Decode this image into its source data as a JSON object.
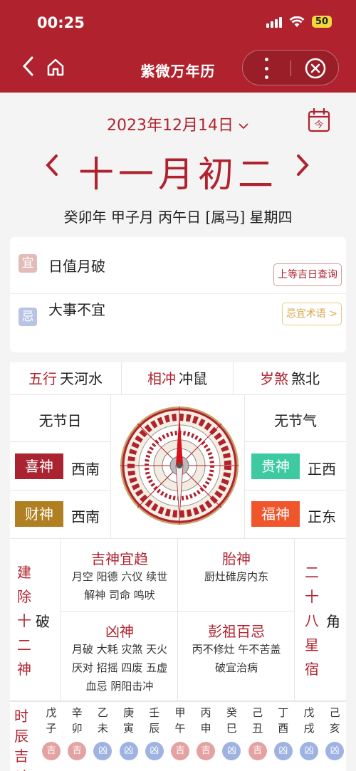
{
  "status": {
    "time": "00:25",
    "battery": "50"
  },
  "nav": {
    "title": "紫微万年历"
  },
  "date": {
    "solar": "2023年12月14日",
    "lunar": "十一月初二",
    "ganzhi": "癸卯年 甲子月 丙午日 [属马] 星期四",
    "today_label": "今"
  },
  "yiji": {
    "yi_badge": "宜",
    "yi_text": "日值月破",
    "yi_link": "上等吉日查询",
    "ji_badge": "忌",
    "ji_text": "大事不宜",
    "ji_link": "忌宜术语 >"
  },
  "info": {
    "wuxing_label": "五行",
    "wuxing_value": "天河水",
    "chong_label": "相冲",
    "chong_value": "冲鼠",
    "sha_label": "岁煞",
    "sha_value": "煞北",
    "jieri": "无节日",
    "jieqi": "无节气",
    "xi_label": "喜神",
    "xi_dir": "西南",
    "cai_label": "财神",
    "cai_dir": "西南",
    "gui_label": "贵神",
    "gui_dir": "正西",
    "fu_label": "福神",
    "fu_dir": "正东",
    "jianchu_col1": [
      "建",
      "除",
      "十",
      "二",
      "神"
    ],
    "jianchu_val": "破",
    "jishen_title": "吉神宜趋",
    "jishen_lines": [
      "月空 阳德 六仪 续世",
      "解神  司命  鸣吠"
    ],
    "taishen_title": "胎神",
    "taishen_lines": [
      "厨灶碓房内东"
    ],
    "xiongshen_title": "凶神",
    "xiongshen_lines": [
      "月破 大耗 灾煞 天火",
      "厌对 招摇 四废 五虚",
      "血忌    阴阳击冲"
    ],
    "pengzu_title": "彭祖百忌",
    "pengzu_lines": [
      "丙不修灶 午不苦盖",
      "破宜治病"
    ],
    "xiu_col": [
      "二",
      "十",
      "八",
      "星",
      "宿"
    ],
    "xiu_val": "角"
  },
  "hours": {
    "label": [
      "时",
      "辰",
      "吉",
      "凶"
    ],
    "items": [
      {
        "top": "戊",
        "bottom": "子",
        "luck": "吉"
      },
      {
        "top": "辛",
        "bottom": "卯",
        "luck": "吉"
      },
      {
        "top": "乙",
        "bottom": "未",
        "luck": "凶"
      },
      {
        "top": "庚",
        "bottom": "寅",
        "luck": "凶"
      },
      {
        "top": "壬",
        "bottom": "辰",
        "luck": "凶"
      },
      {
        "top": "甲",
        "bottom": "午",
        "luck": "吉"
      },
      {
        "top": "丙",
        "bottom": "申",
        "luck": "吉"
      },
      {
        "top": "癸",
        "bottom": "巳",
        "luck": "凶"
      },
      {
        "top": "己",
        "bottom": "丑",
        "luck": "吉"
      },
      {
        "top": "丁",
        "bottom": "酉",
        "luck": "凶"
      },
      {
        "top": "戊",
        "bottom": "戌",
        "luck": "凶"
      },
      {
        "top": "己",
        "bottom": "亥",
        "luck": "凶"
      }
    ]
  },
  "colors": {
    "brand": "#b0232e",
    "xi": "#a92430",
    "cai": "#b07f21",
    "gui": "#3dcaa0",
    "fu": "#f0562c",
    "good": "#e4a2a2",
    "bad": "#9fb3e2"
  }
}
